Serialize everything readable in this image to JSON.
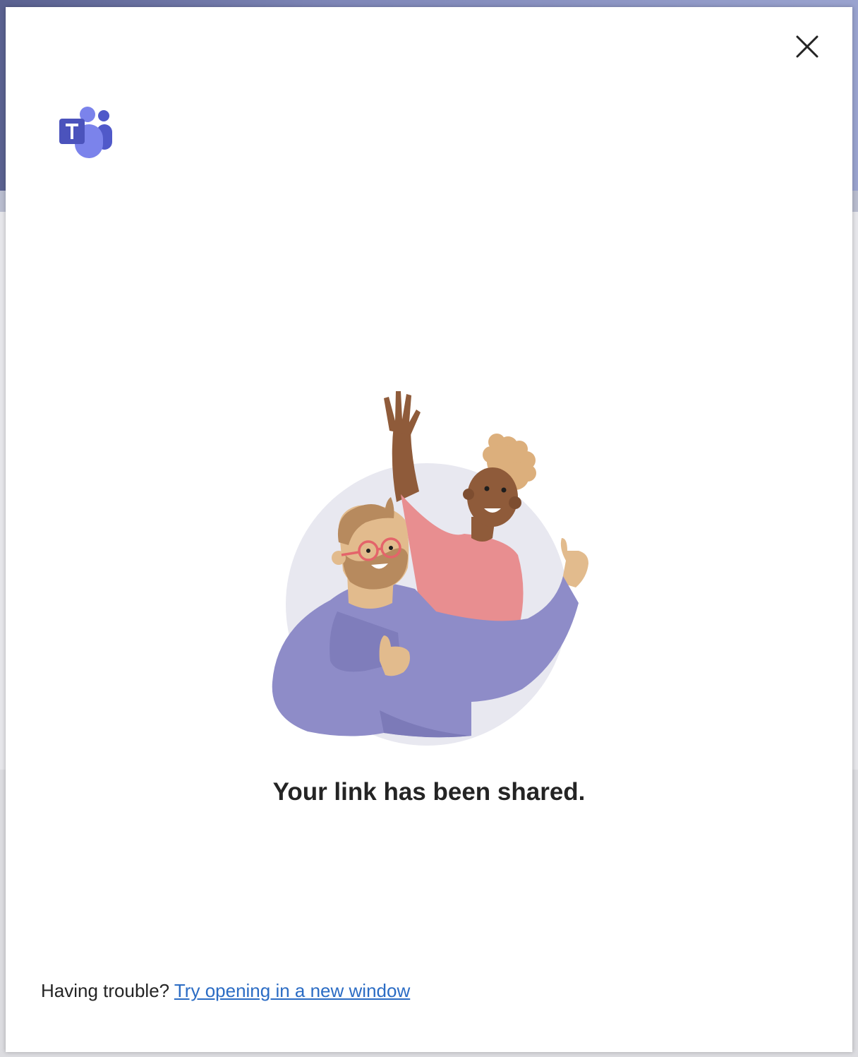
{
  "dialog": {
    "headline": "Your link has been shared.",
    "trouble_prefix": "Having trouble?",
    "trouble_link": "Try opening in a new window",
    "close_label": "Close"
  },
  "icons": {
    "close": "close-icon",
    "logo": "teams-logo-icon",
    "illustration": "people-celebrating-illustration"
  },
  "colors": {
    "teams_purple": "#5059c9",
    "teams_light_purple": "#7b83eb",
    "link_blue": "#2b6cc4",
    "headline_text": "#242424"
  }
}
